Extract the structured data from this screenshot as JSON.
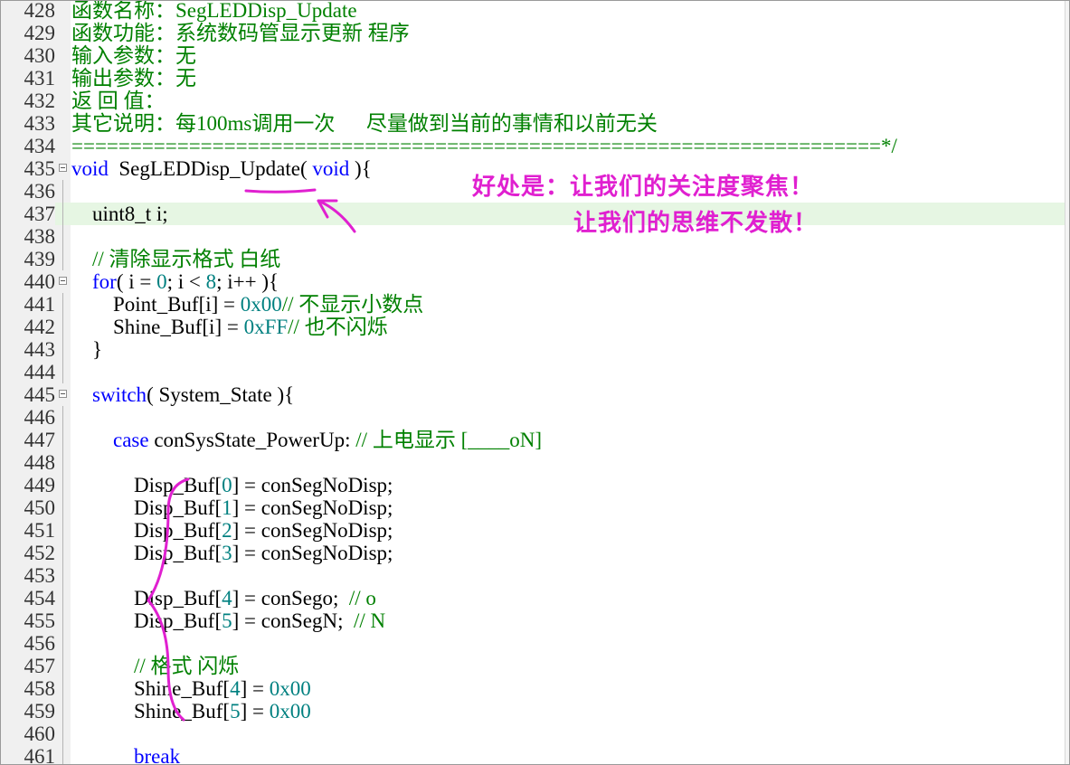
{
  "editor": {
    "lines": [
      {
        "n": "428",
        "segs": [
          [
            "cm",
            "函数名称：SegLEDDisp_Update"
          ]
        ]
      },
      {
        "n": "429",
        "segs": [
          [
            "cm",
            "函数功能：系统数码管显示更新 程序"
          ]
        ]
      },
      {
        "n": "430",
        "segs": [
          [
            "cm",
            "输入参数：无"
          ]
        ]
      },
      {
        "n": "431",
        "segs": [
          [
            "cm",
            "输出参数：无"
          ]
        ]
      },
      {
        "n": "432",
        "segs": [
          [
            "cm",
            "返 回 值："
          ]
        ]
      },
      {
        "n": "433",
        "segs": [
          [
            "cm",
            "其它说明：每100ms调用一次      尽量做到当前的事情和以前无关"
          ]
        ]
      },
      {
        "n": "434",
        "segs": [
          [
            "cm",
            "=====================================================================*/"
          ]
        ]
      },
      {
        "n": "435",
        "fold": true,
        "segs": [
          [
            "kw",
            "void"
          ],
          [
            "",
            "  SegLEDDisp_Update( "
          ],
          [
            "kw",
            "void"
          ],
          [
            "",
            " ){"
          ]
        ]
      },
      {
        "n": "436",
        "segs": []
      },
      {
        "n": "437",
        "current": true,
        "segs": [
          [
            "",
            "    uint8_t i;"
          ]
        ]
      },
      {
        "n": "438",
        "segs": []
      },
      {
        "n": "439",
        "segs": [
          [
            "",
            "    "
          ],
          [
            "cm",
            "// 清除显示格式 白纸"
          ]
        ]
      },
      {
        "n": "440",
        "fold": true,
        "segs": [
          [
            "",
            "    "
          ],
          [
            "kw",
            "for"
          ],
          [
            "",
            "( i = "
          ],
          [
            "nm",
            "0"
          ],
          [
            "",
            "; i < "
          ],
          [
            "nm",
            "8"
          ],
          [
            "",
            "; i++ ){"
          ]
        ]
      },
      {
        "n": "441",
        "segs": [
          [
            "",
            "        Point_Buf[i] = "
          ],
          [
            "nm",
            "0x00"
          ],
          [
            ";  "
          ],
          [
            "cm",
            "// 不显示小数点"
          ]
        ]
      },
      {
        "n": "442",
        "segs": [
          [
            "",
            "        Shine_Buf[i] = "
          ],
          [
            "nm",
            "0xFF"
          ],
          [
            ";  "
          ],
          [
            "cm",
            "// 也不闪烁"
          ]
        ]
      },
      {
        "n": "443",
        "segs": [
          [
            "",
            "    }"
          ]
        ]
      },
      {
        "n": "444",
        "segs": []
      },
      {
        "n": "445",
        "fold": true,
        "segs": [
          [
            "",
            "    "
          ],
          [
            "kw",
            "switch"
          ],
          [
            "",
            "( System_State ){"
          ]
        ]
      },
      {
        "n": "446",
        "segs": []
      },
      {
        "n": "447",
        "segs": [
          [
            "",
            "        "
          ],
          [
            "kw",
            "case"
          ],
          [
            "",
            " conSysState_PowerUp: "
          ],
          [
            "cm",
            "// 上电显示 [____oN]"
          ]
        ]
      },
      {
        "n": "448",
        "segs": []
      },
      {
        "n": "449",
        "segs": [
          [
            "",
            "            Disp_Buf["
          ],
          [
            "nm",
            "0"
          ],
          [
            "",
            "] = conSegNoDisp;"
          ]
        ]
      },
      {
        "n": "450",
        "segs": [
          [
            "",
            "            Disp_Buf["
          ],
          [
            "nm",
            "1"
          ],
          [
            "",
            "] = conSegNoDisp;"
          ]
        ]
      },
      {
        "n": "451",
        "segs": [
          [
            "",
            "            Disp_Buf["
          ],
          [
            "nm",
            "2"
          ],
          [
            "",
            "] = conSegNoDisp;"
          ]
        ]
      },
      {
        "n": "452",
        "segs": [
          [
            "",
            "            Disp_Buf["
          ],
          [
            "nm",
            "3"
          ],
          [
            "",
            "] = conSegNoDisp;"
          ]
        ]
      },
      {
        "n": "453",
        "segs": []
      },
      {
        "n": "454",
        "segs": [
          [
            "",
            "            Disp_Buf["
          ],
          [
            "nm",
            "4"
          ],
          [
            "",
            "] = conSego;  "
          ],
          [
            "cm",
            "// o"
          ]
        ]
      },
      {
        "n": "455",
        "segs": [
          [
            "",
            "            Disp_Buf["
          ],
          [
            "nm",
            "5"
          ],
          [
            "",
            "] = conSegN;  "
          ],
          [
            "cm",
            "// N"
          ]
        ]
      },
      {
        "n": "456",
        "segs": []
      },
      {
        "n": "457",
        "segs": [
          [
            "",
            "            "
          ],
          [
            "cm",
            "// 格式 闪烁"
          ]
        ]
      },
      {
        "n": "458",
        "segs": [
          [
            "",
            "            Shine_Buf["
          ],
          [
            "nm",
            "4"
          ],
          [
            "",
            "] = "
          ],
          [
            "nm",
            "0x00"
          ],
          [
            ";"
          ]
        ]
      },
      {
        "n": "459",
        "segs": [
          [
            "",
            "            Shine_Buf["
          ],
          [
            "nm",
            "5"
          ],
          [
            "",
            "] = "
          ],
          [
            "nm",
            "0x00"
          ],
          [
            ";"
          ]
        ]
      },
      {
        "n": "460",
        "segs": []
      },
      {
        "n": "461",
        "segs": [
          [
            "",
            "            "
          ],
          [
            "kw",
            "break"
          ],
          [
            ";"
          ]
        ]
      }
    ]
  },
  "annotation": {
    "line1": "好处是：让我们的关注度聚焦！",
    "line2": "让我们的思维不发散！",
    "color": "#e020d0"
  },
  "colors": {
    "comment": "#008000",
    "keyword": "#0000ff",
    "number": "#008080",
    "current_line": "#e6f6e3"
  }
}
